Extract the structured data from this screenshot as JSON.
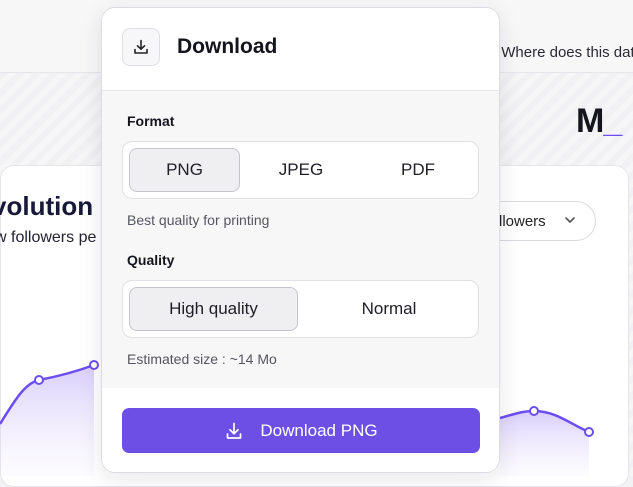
{
  "background": {
    "help_link": "Where does this data",
    "logo_text": "M",
    "logo_underscore": "_",
    "card_title": "volution o",
    "card_subtitle": "w followers pe",
    "metric_select": "llowers",
    "accent_color": "#6c4df0"
  },
  "dialog": {
    "title": "Download",
    "header_icon": "download-icon",
    "format": {
      "label": "Format",
      "options": [
        "PNG",
        "JPEG",
        "PDF"
      ],
      "selected": "PNG",
      "hint": "Best quality for printing"
    },
    "quality": {
      "label": "Quality",
      "options": [
        "High quality",
        "Normal"
      ],
      "selected": "High quality",
      "estimate": "Estimated size : ~14 Mo"
    },
    "download_button": {
      "label": "Download PNG",
      "icon": "download-icon",
      "color": "#6e4fe6"
    }
  }
}
